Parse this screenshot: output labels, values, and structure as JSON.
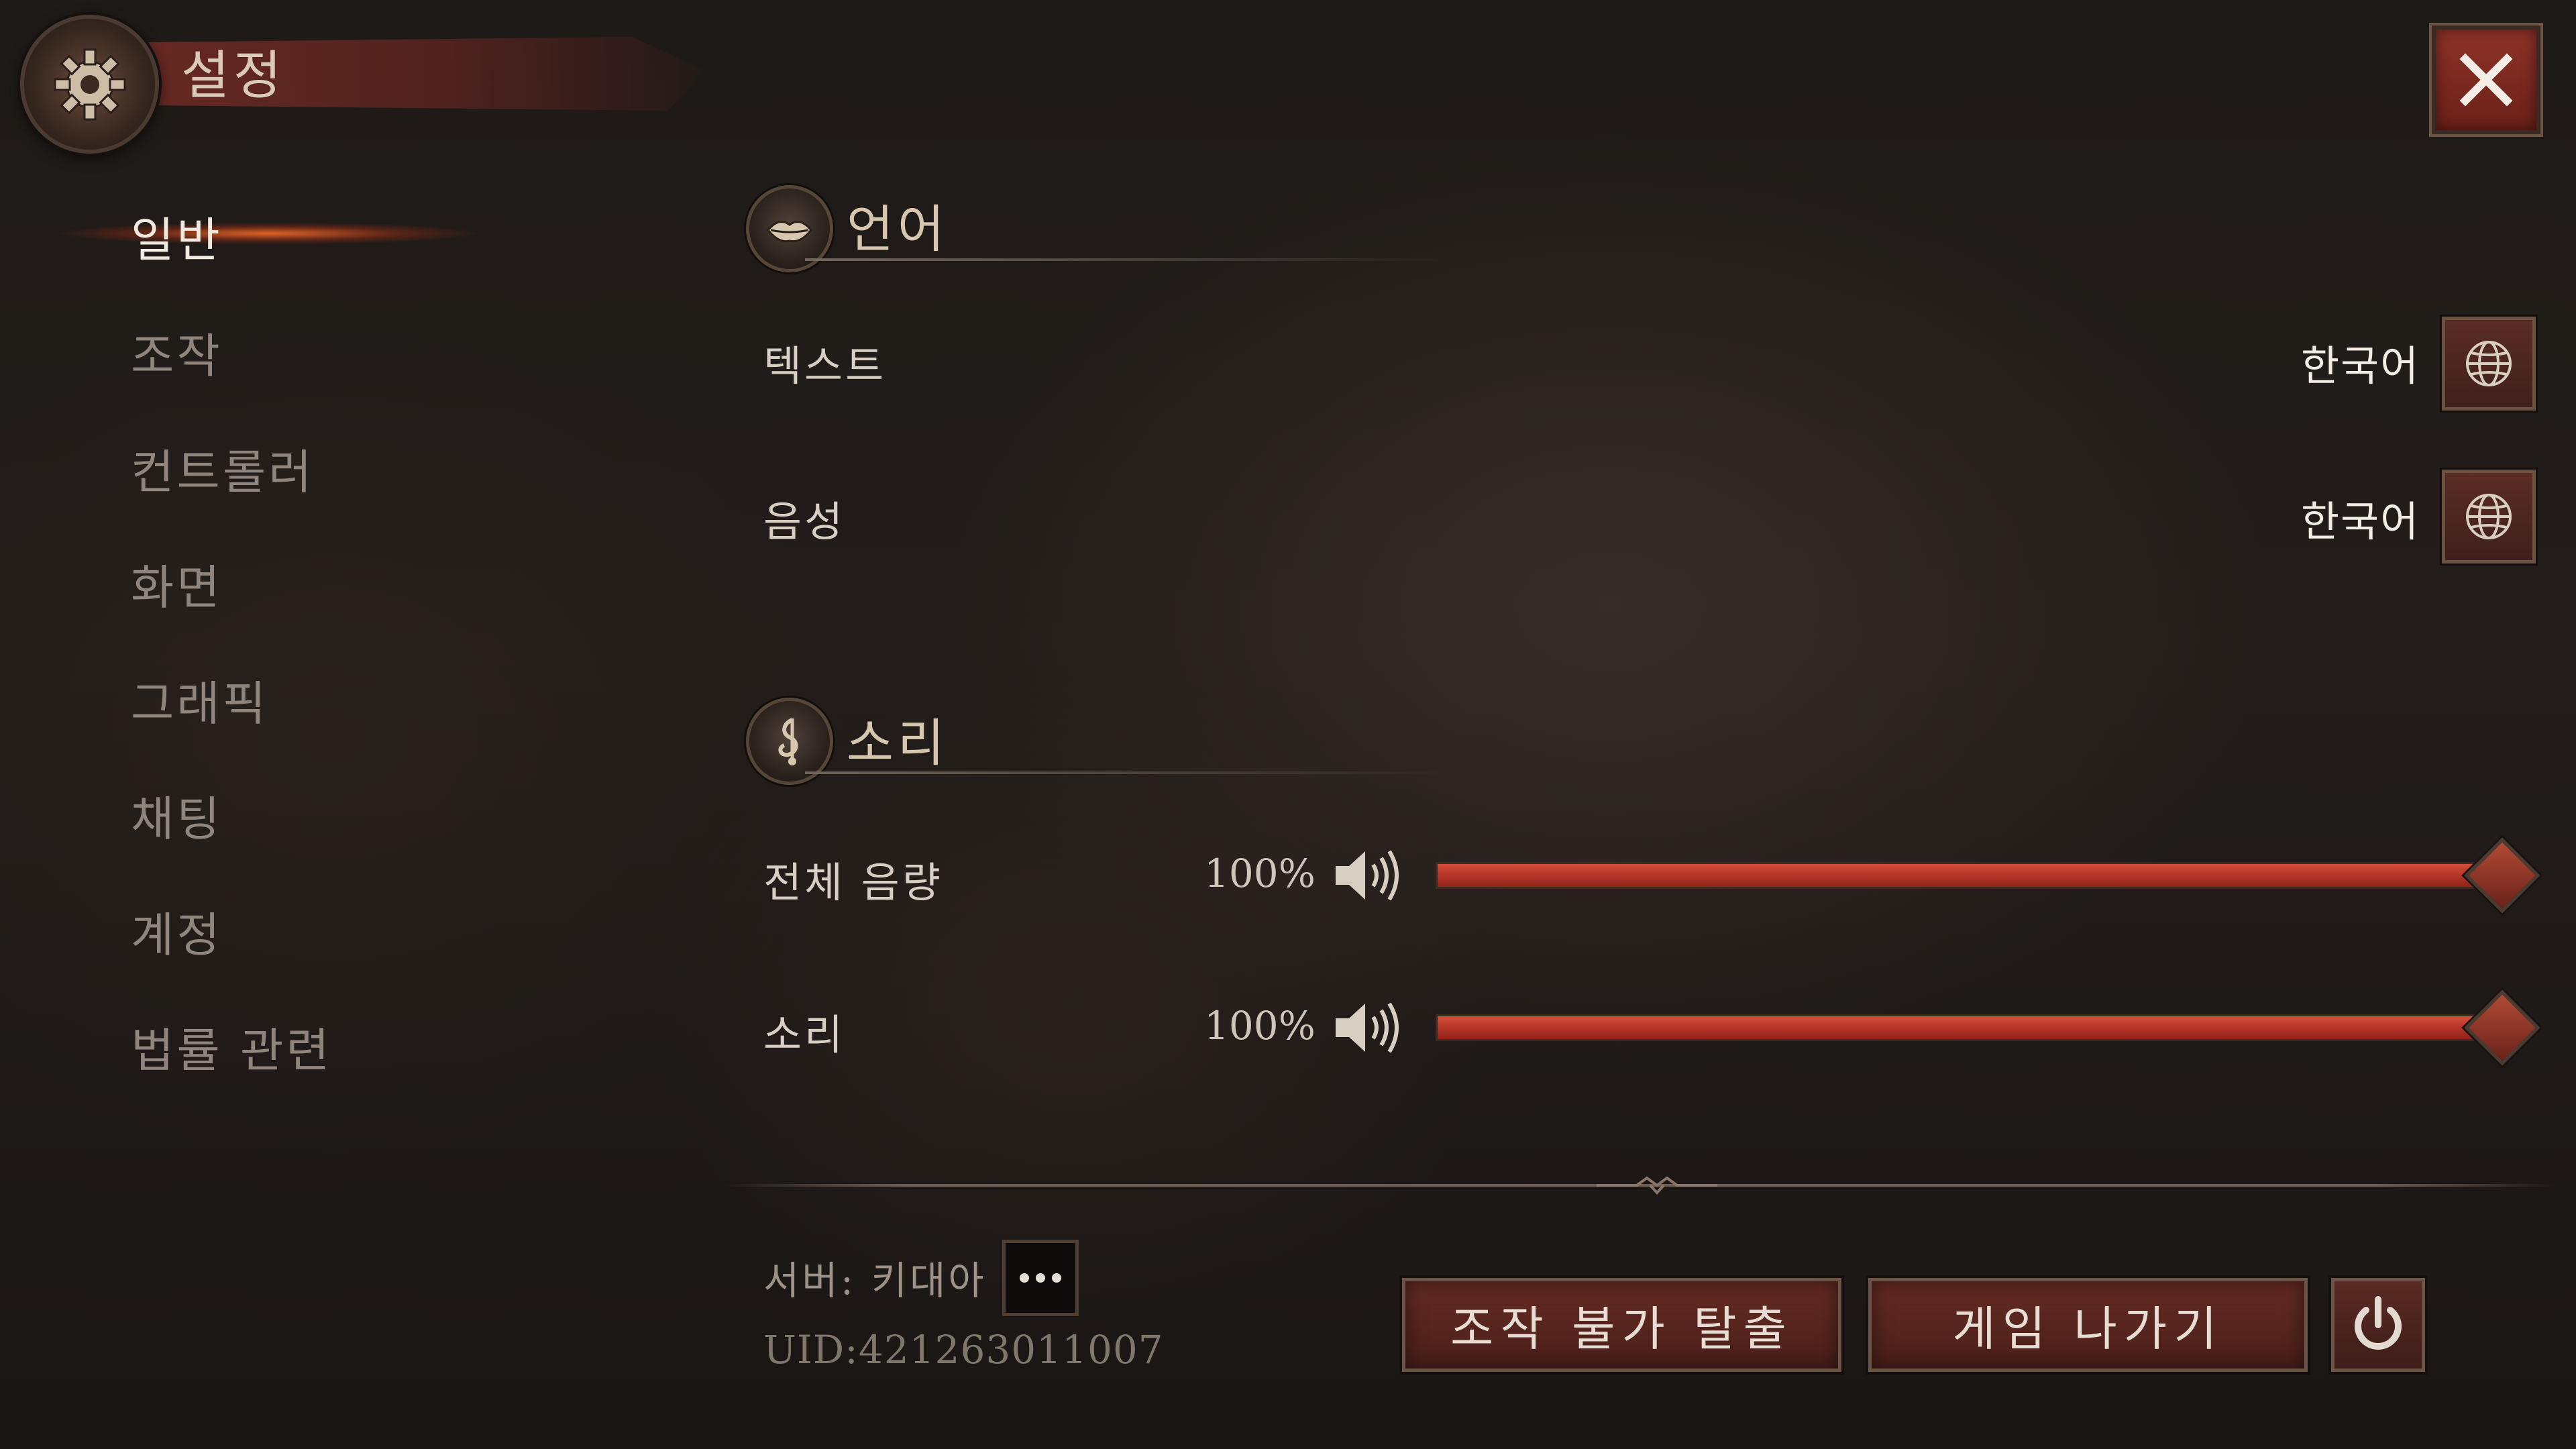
{
  "header": {
    "title": "설정",
    "icon": "gear-icon"
  },
  "close_button": {
    "icon": "close-icon"
  },
  "sidebar": {
    "items": [
      {
        "label": "일반",
        "active": true
      },
      {
        "label": "조작",
        "active": false
      },
      {
        "label": "컨트롤러",
        "active": false
      },
      {
        "label": "화면",
        "active": false
      },
      {
        "label": "그래픽",
        "active": false
      },
      {
        "label": "채팅",
        "active": false
      },
      {
        "label": "계정",
        "active": false
      },
      {
        "label": "법률 관련",
        "active": false
      }
    ]
  },
  "language_section": {
    "title": "언어",
    "icon": "lips-icon",
    "rows": [
      {
        "label": "텍스트",
        "value": "한국어",
        "button_icon": "globe-icon"
      },
      {
        "label": "음성",
        "value": "한국어",
        "button_icon": "globe-icon"
      }
    ]
  },
  "sound_section": {
    "title": "소리",
    "icon": "music-note-icon",
    "rows": [
      {
        "label": "전체 음량",
        "percent_text": "100%",
        "level": 1.0,
        "icon": "speaker-icon"
      },
      {
        "label": "소리",
        "percent_text": "100%",
        "level": 1.0,
        "icon": "speaker-icon"
      }
    ]
  },
  "footer": {
    "server_label": "서버: 키대아",
    "uid": "UID:421263011007",
    "more_icon": "ellipsis-icon",
    "stuck_button": "조작 불가 탈출",
    "exit_button": "게임 나가기",
    "power_icon": "power-icon"
  },
  "colors": {
    "accent_red": "#b9372a",
    "active_glow": "#ff6e28",
    "text_light": "#f2ece4",
    "text_dim": "#8f857c"
  }
}
